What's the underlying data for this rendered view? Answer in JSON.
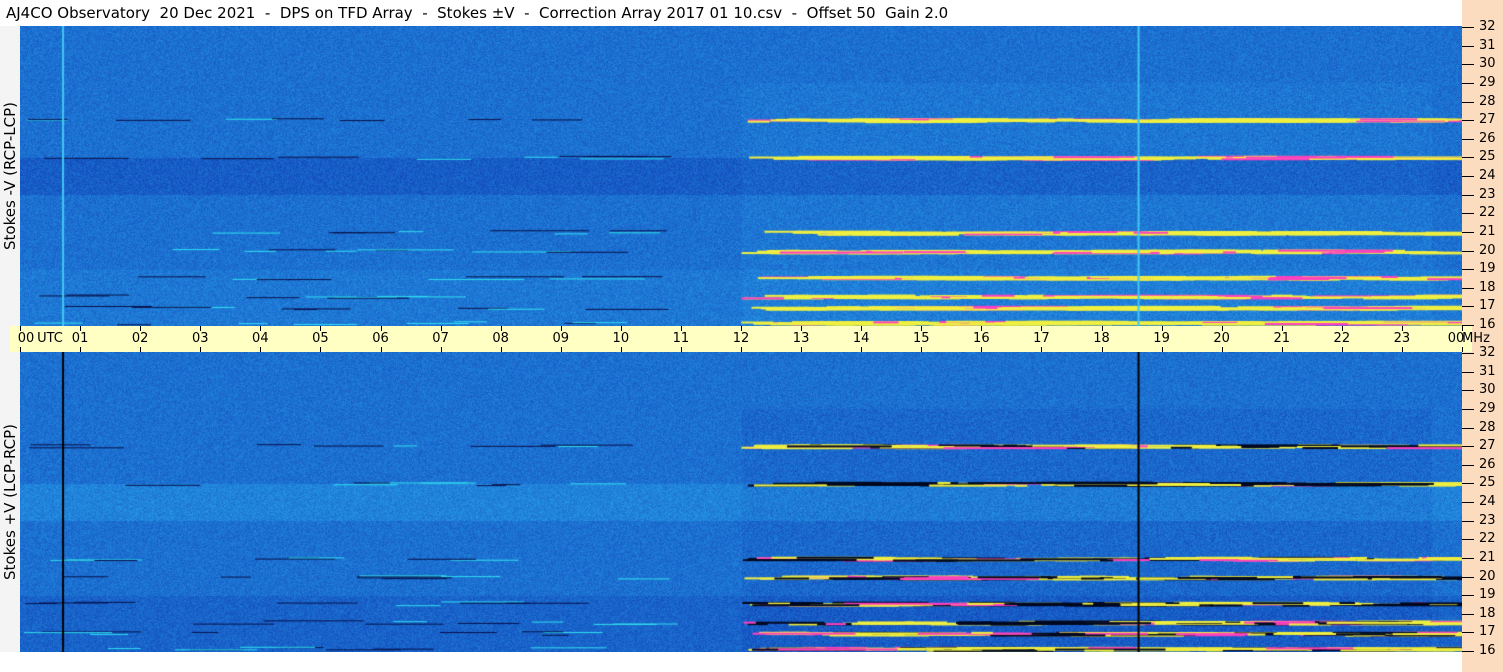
{
  "title": "AJ4CO Observatory  20 Dec 2021  -  DPS on TFD Array  -  Stokes ±V  -  Correction Array 2017 01 10.csv  -  Offset 50  Gain 2.0",
  "chart_data": {
    "type": "heatmap",
    "title": "AJ4CO Observatory  20 Dec 2021  -  DPS on TFD Array  -  Stokes ±V  -  Correction Array 2017 01 10.csv  -  Offset 50  Gain 2.0",
    "x_axis": {
      "unit_label": "UTC",
      "ticks": [
        "00",
        "01",
        "02",
        "03",
        "04",
        "05",
        "06",
        "07",
        "08",
        "09",
        "10",
        "11",
        "12",
        "13",
        "14",
        "15",
        "16",
        "17",
        "18",
        "19",
        "20",
        "21",
        "22",
        "23",
        "00"
      ],
      "range_hours": [
        0,
        24
      ]
    },
    "y_axis": {
      "unit_label": "MHz",
      "ticks": [
        16,
        17,
        18,
        19,
        20,
        21,
        22,
        23,
        24,
        25,
        26,
        27,
        28,
        29,
        30,
        31,
        32
      ],
      "range": [
        16,
        32
      ]
    },
    "panels": [
      {
        "label": "Stokes -V (RCP-LCP)",
        "marker_line_color": "#40c8f0"
      },
      {
        "label": "Stokes +V (LCP-RCP)",
        "marker_line_color": "#000000"
      }
    ],
    "marker_times_utc": [
      0.7,
      18.6
    ],
    "bright_band_freqs_mhz": [
      16.2,
      17,
      17.6,
      18.6,
      20,
      21,
      25,
      27
    ],
    "colors": {
      "background_low": "#0a2a9a",
      "background_mid": "#1060e0",
      "background_high": "#30a0ff",
      "signal": "#f0f040",
      "hot": "#ff40c0"
    }
  }
}
